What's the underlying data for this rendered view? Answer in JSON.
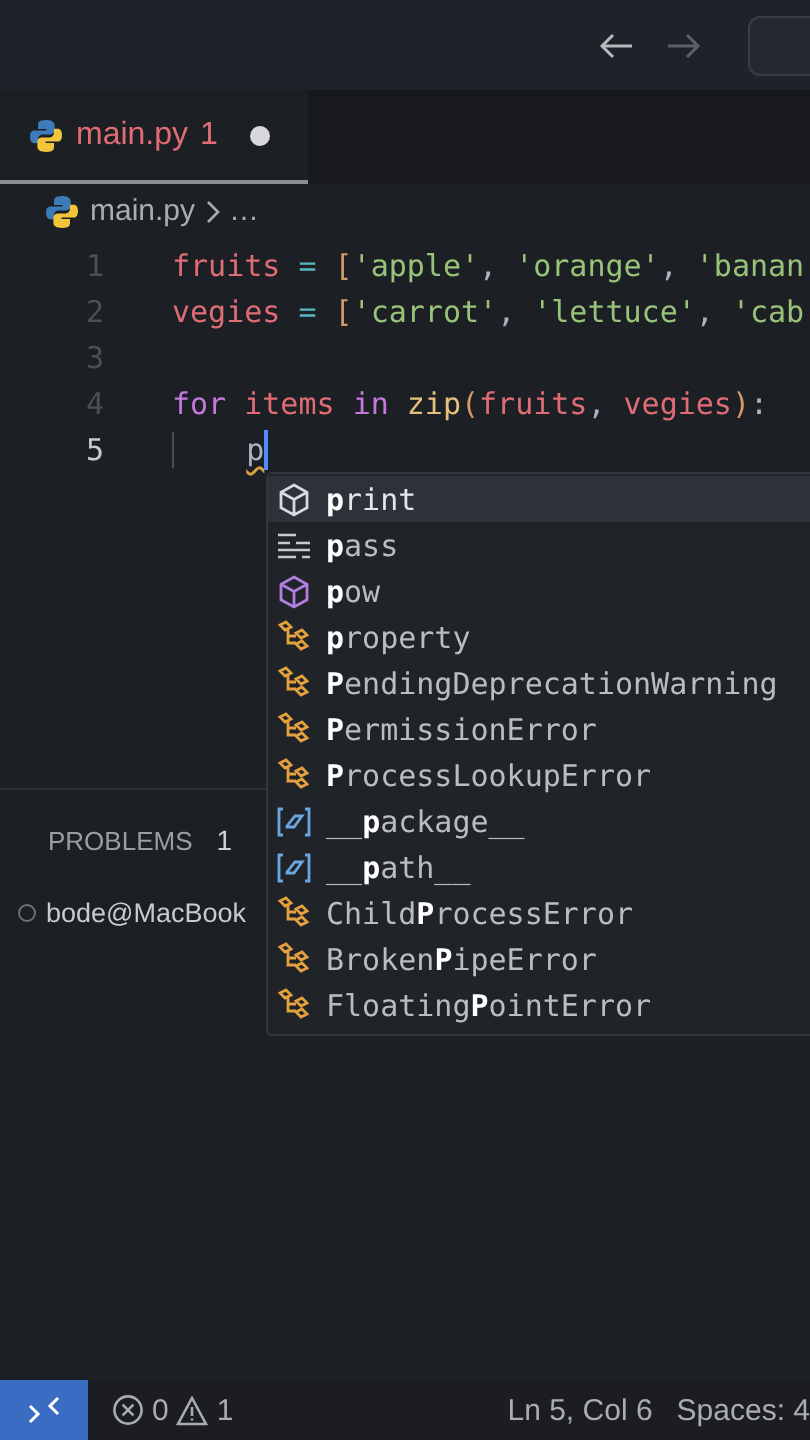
{
  "nav": {
    "back_enabled": true,
    "forward_enabled": false
  },
  "tab": {
    "label": "main.py",
    "problems": "1",
    "modified": true,
    "selected": true
  },
  "breadcrumb": [
    "main.py",
    "…"
  ],
  "code": [
    {
      "number": "1",
      "current": false,
      "indent_guide": false,
      "tokens": [
        {
          "text": "fruits",
          "kind": "var"
        },
        {
          "text": " = ",
          "kind": "op"
        },
        {
          "text": "[",
          "kind": "bracket"
        },
        {
          "text": "'apple'",
          "kind": "str"
        },
        {
          "text": ", ",
          "kind": "plain"
        },
        {
          "text": "'orange'",
          "kind": "str"
        },
        {
          "text": ", ",
          "kind": "plain"
        },
        {
          "text": "'banan",
          "kind": "str"
        }
      ]
    },
    {
      "number": "2",
      "current": false,
      "indent_guide": false,
      "tokens": [
        {
          "text": "vegies",
          "kind": "var"
        },
        {
          "text": " = ",
          "kind": "op"
        },
        {
          "text": "[",
          "kind": "bracket"
        },
        {
          "text": "'carrot'",
          "kind": "str"
        },
        {
          "text": ", ",
          "kind": "plain"
        },
        {
          "text": "'lettuce'",
          "kind": "str"
        },
        {
          "text": ", ",
          "kind": "plain"
        },
        {
          "text": "'cab",
          "kind": "str"
        }
      ]
    },
    {
      "number": "3",
      "current": false,
      "indent_guide": false
    },
    {
      "number": "4",
      "current": false,
      "indent_guide": false,
      "tokens": [
        {
          "text": "for ",
          "kind": "kw"
        },
        {
          "text": "items ",
          "kind": "var"
        },
        {
          "text": "in ",
          "kind": "kw"
        },
        {
          "text": "zip",
          "kind": "fn"
        },
        {
          "text": "(",
          "kind": "bracket"
        },
        {
          "text": "fruits",
          "kind": "var"
        },
        {
          "text": ", ",
          "kind": "plain"
        },
        {
          "text": "vegies",
          "kind": "var"
        },
        {
          "text": ")",
          "kind": "bracket"
        },
        {
          "text": ":",
          "kind": "plain"
        }
      ]
    },
    {
      "number": "5",
      "current": true,
      "indent_guide": true,
      "tokens": [
        {
          "text": "p",
          "kind": "warn"
        }
      ]
    }
  ],
  "suggestions": [
    {
      "label": "**p**rint",
      "kind": "method",
      "selected": true
    },
    {
      "label": "**p**ass",
      "kind": "keyword",
      "selected": false
    },
    {
      "label": "**p**ow",
      "kind": "function",
      "selected": false
    },
    {
      "label": "**p**roperty",
      "kind": "class",
      "selected": false
    },
    {
      "label": "**P**endingDeprecationWarning",
      "kind": "class",
      "selected": false
    },
    {
      "label": "**P**ermissionError",
      "kind": "class",
      "selected": false
    },
    {
      "label": "**P**rocessLookupError",
      "kind": "class",
      "selected": false
    },
    {
      "label": "__**p**ackage__",
      "kind": "variable",
      "selected": false
    },
    {
      "label": "__**p**ath__",
      "kind": "variable",
      "selected": false
    },
    {
      "label": "Child**P**rocessError",
      "kind": "class",
      "selected": false
    },
    {
      "label": "Broken**P**ipeError",
      "kind": "class",
      "selected": false
    },
    {
      "label": "Floating**P**ointError",
      "kind": "class",
      "selected": false
    }
  ],
  "panel": {
    "title": "PROBLEMS",
    "count": "1"
  },
  "terminal": {
    "prompt": "bode@MacBook"
  },
  "status_bar": {
    "errors": "0",
    "warnings": "1",
    "position": "Ln 5, Col 6",
    "indent": "Spaces: 4"
  }
}
